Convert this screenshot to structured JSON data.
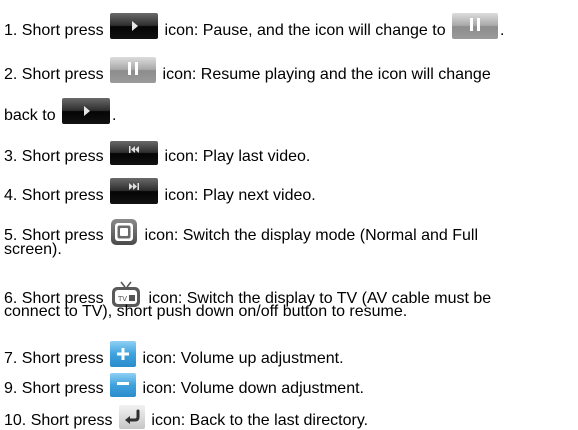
{
  "items": [
    {
      "before": "1. Short press",
      "after": "icon: Pause, and the icon will change to",
      "tail": "."
    },
    {
      "before": "2. Short press",
      "after": "icon: Resume playing and the icon will change",
      "cont_before": "back to",
      "cont_after": "."
    },
    {
      "before": "3. Short press",
      "after": "icon: Play last video."
    },
    {
      "before": "4. Short press",
      "after": "icon: Play next video."
    },
    {
      "before": "5. Short press",
      "after": "icon: Switch the display mode (Normal and Full",
      "cont": "screen)."
    },
    {
      "before": "6. Short press",
      "after": "icon: Switch the display to TV (AV cable must be",
      "cont": "connect to TV), short push down on/off button to resume."
    },
    {
      "before": "7. Short press",
      "after": "icon: Volume up adjustment."
    },
    {
      "before": "9. Short press",
      "after": "icon: Volume down adjustment."
    },
    {
      "before": "10. Short press",
      "after": "icon: Back to the last directory."
    }
  ],
  "icons": {
    "play": "play-icon",
    "pause": "pause-icon",
    "previous": "previous-icon",
    "next": "next-icon",
    "display_mode": "display-mode-icon",
    "tv": "tv-icon",
    "volume_up": "volume-up-icon",
    "volume_down": "volume-down-icon",
    "back": "back-icon"
  },
  "colors": {
    "text": "#000000",
    "dark_button": "#111111",
    "pause_button": "#a0a0a0",
    "volume_button": "#3fa2de"
  }
}
